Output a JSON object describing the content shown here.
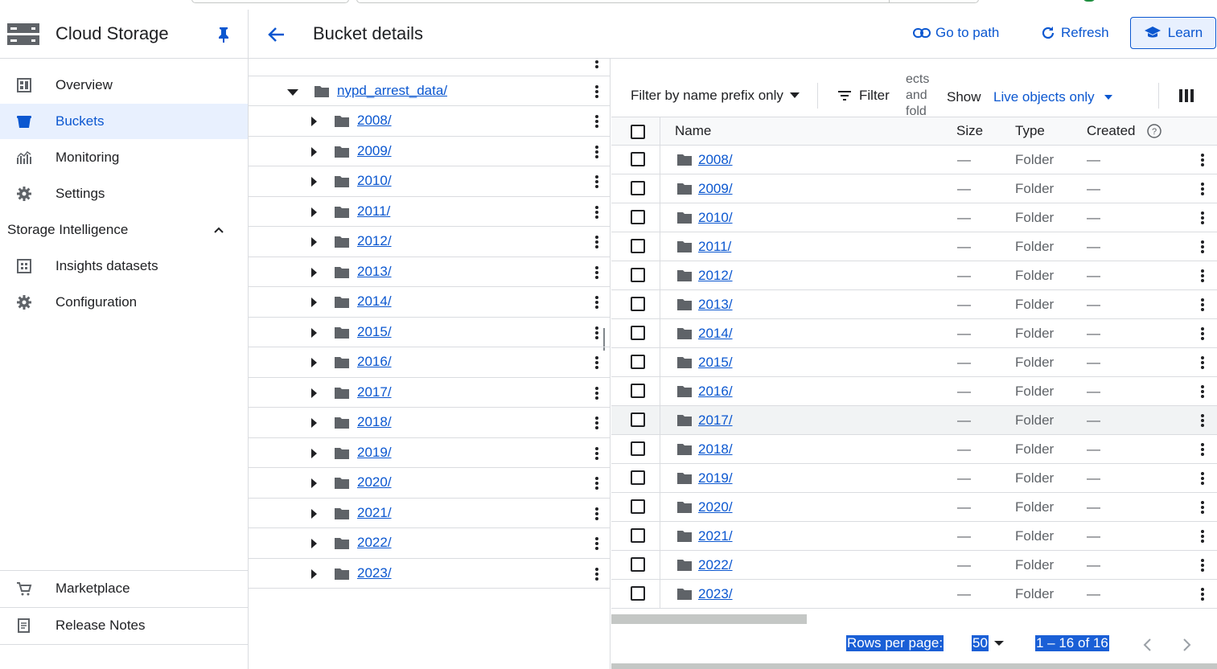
{
  "nav": {
    "app_title": "Cloud Storage",
    "items": [
      {
        "label": "Overview",
        "icon": "dashboard-icon",
        "active": false
      },
      {
        "label": "Buckets",
        "icon": "bucket-icon",
        "active": true
      },
      {
        "label": "Monitoring",
        "icon": "monitoring-icon",
        "active": false
      },
      {
        "label": "Settings",
        "icon": "gear-icon",
        "active": false
      }
    ],
    "section": {
      "label": "Storage Intelligence",
      "expanded": true
    },
    "section_items": [
      {
        "label": "Insights datasets",
        "icon": "dataset-icon"
      },
      {
        "label": "Configuration",
        "icon": "gear-icon"
      }
    ],
    "bottom_items": [
      {
        "label": "Marketplace",
        "icon": "cart-icon"
      },
      {
        "label": "Release Notes",
        "icon": "notes-icon"
      }
    ]
  },
  "header": {
    "title": "Bucket details",
    "go_to_path": "Go to path",
    "refresh": "Refresh",
    "learn": "Learn"
  },
  "tree": {
    "root": "nypd_arrest_data/",
    "folders": [
      "2008/",
      "2009/",
      "2010/",
      "2011/",
      "2012/",
      "2013/",
      "2014/",
      "2015/",
      "2016/",
      "2017/",
      "2018/",
      "2019/",
      "2020/",
      "2021/",
      "2022/",
      "2023/"
    ]
  },
  "filters": {
    "prefix_label": "Filter by name prefix only",
    "filter_label": "Filter",
    "wrapped_hint": "ects and folders",
    "show_label": "Show",
    "show_value": "Live objects only"
  },
  "table": {
    "columns": {
      "name": "Name",
      "size": "Size",
      "type": "Type",
      "created": "Created"
    },
    "rows": [
      {
        "name": "2008/",
        "size": "—",
        "type": "Folder",
        "created": "—"
      },
      {
        "name": "2009/",
        "size": "—",
        "type": "Folder",
        "created": "—"
      },
      {
        "name": "2010/",
        "size": "—",
        "type": "Folder",
        "created": "—"
      },
      {
        "name": "2011/",
        "size": "—",
        "type": "Folder",
        "created": "—"
      },
      {
        "name": "2012/",
        "size": "—",
        "type": "Folder",
        "created": "—"
      },
      {
        "name": "2013/",
        "size": "—",
        "type": "Folder",
        "created": "—"
      },
      {
        "name": "2014/",
        "size": "—",
        "type": "Folder",
        "created": "—"
      },
      {
        "name": "2015/",
        "size": "—",
        "type": "Folder",
        "created": "—"
      },
      {
        "name": "2016/",
        "size": "—",
        "type": "Folder",
        "created": "—"
      },
      {
        "name": "2017/",
        "size": "—",
        "type": "Folder",
        "created": "—"
      },
      {
        "name": "2018/",
        "size": "—",
        "type": "Folder",
        "created": "—"
      },
      {
        "name": "2019/",
        "size": "—",
        "type": "Folder",
        "created": "—"
      },
      {
        "name": "2020/",
        "size": "—",
        "type": "Folder",
        "created": "—"
      },
      {
        "name": "2021/",
        "size": "—",
        "type": "Folder",
        "created": "—"
      },
      {
        "name": "2022/",
        "size": "—",
        "type": "Folder",
        "created": "—"
      },
      {
        "name": "2023/",
        "size": "—",
        "type": "Folder",
        "created": "—"
      }
    ]
  },
  "pager": {
    "rows_per_page_label": "Rows per page:",
    "rows_per_page_value": "50",
    "range": "1 – 16 of 16"
  },
  "colors": {
    "accent": "#0b57d0",
    "active_bg": "#e8f0fe",
    "border": "#dadce0"
  }
}
